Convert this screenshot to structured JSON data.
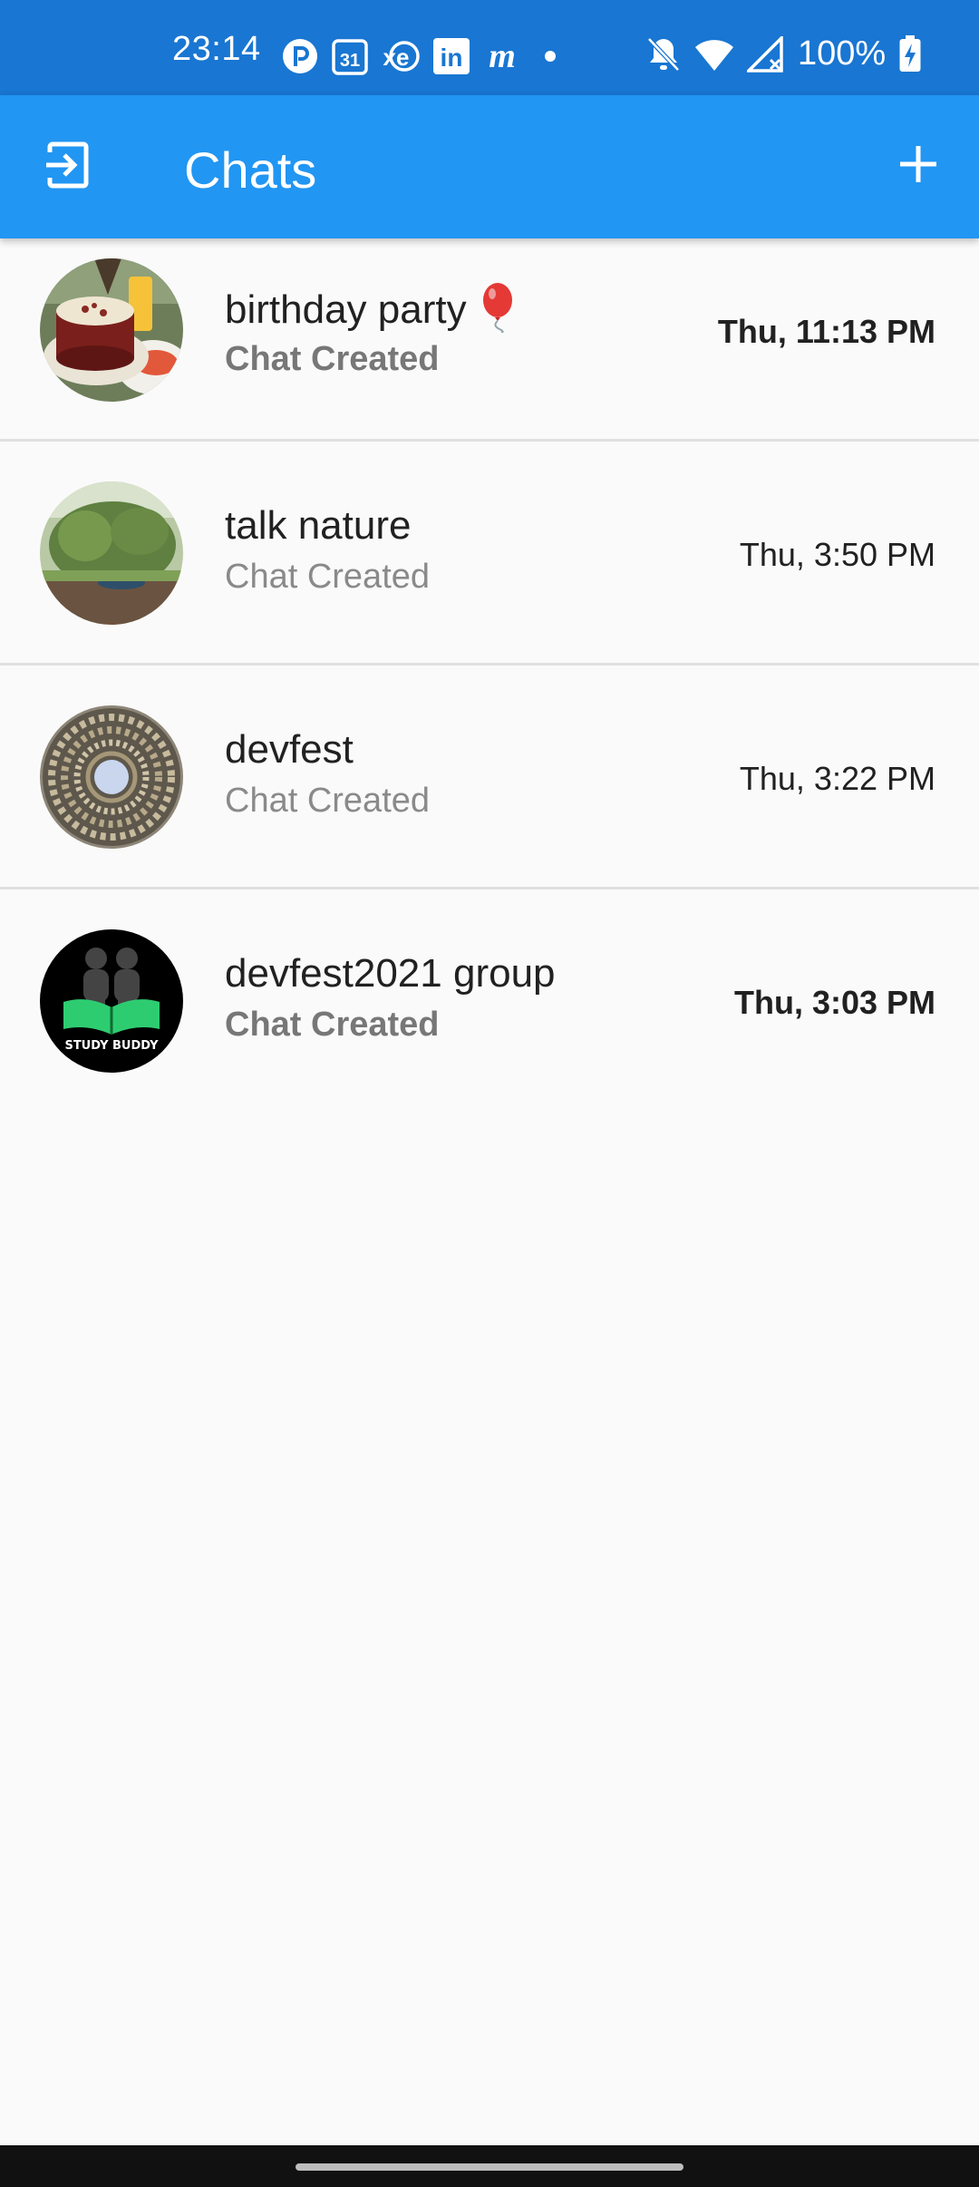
{
  "status_bar": {
    "time": "23:14",
    "battery": "100%",
    "notification_icons": [
      "pinterest-style-p-icon",
      "calendar-31-icon",
      "xe-icon",
      "linkedin-icon",
      "m-app-icon",
      "dot-icon"
    ],
    "system_icons": [
      "bell-off-icon",
      "wifi-icon",
      "signal-icon",
      "battery-charging-icon"
    ],
    "calendar_day": "31",
    "xe_label": "xe",
    "linkedin_label": "in",
    "m_label": "m"
  },
  "app_bar": {
    "title": "Chats",
    "left_icon": "logout-icon",
    "right_icon": "add-icon",
    "color": "#2196f3",
    "status_color": "#1976d2"
  },
  "chats": [
    {
      "name": "birthday party",
      "subtitle": "Chat Created",
      "time": "Thu, 11:13 PM",
      "unread": true,
      "emoji_icon": "balloon-icon",
      "avatar_icon": "cake-photo"
    },
    {
      "name": "talk nature",
      "subtitle": "Chat Created",
      "time": "Thu, 3:50 PM",
      "unread": false,
      "avatar_icon": "garden-photo"
    },
    {
      "name": "devfest",
      "subtitle": "Chat Created",
      "time": "Thu, 3:22 PM",
      "unread": false,
      "avatar_icon": "mirror-photo"
    },
    {
      "name": "devfest2021 group",
      "subtitle": "Chat Created",
      "time": "Thu, 3:03 PM",
      "unread": true,
      "avatar_icon": "study-buddy-logo",
      "avatar_text": "STUDY BUDDY"
    }
  ]
}
